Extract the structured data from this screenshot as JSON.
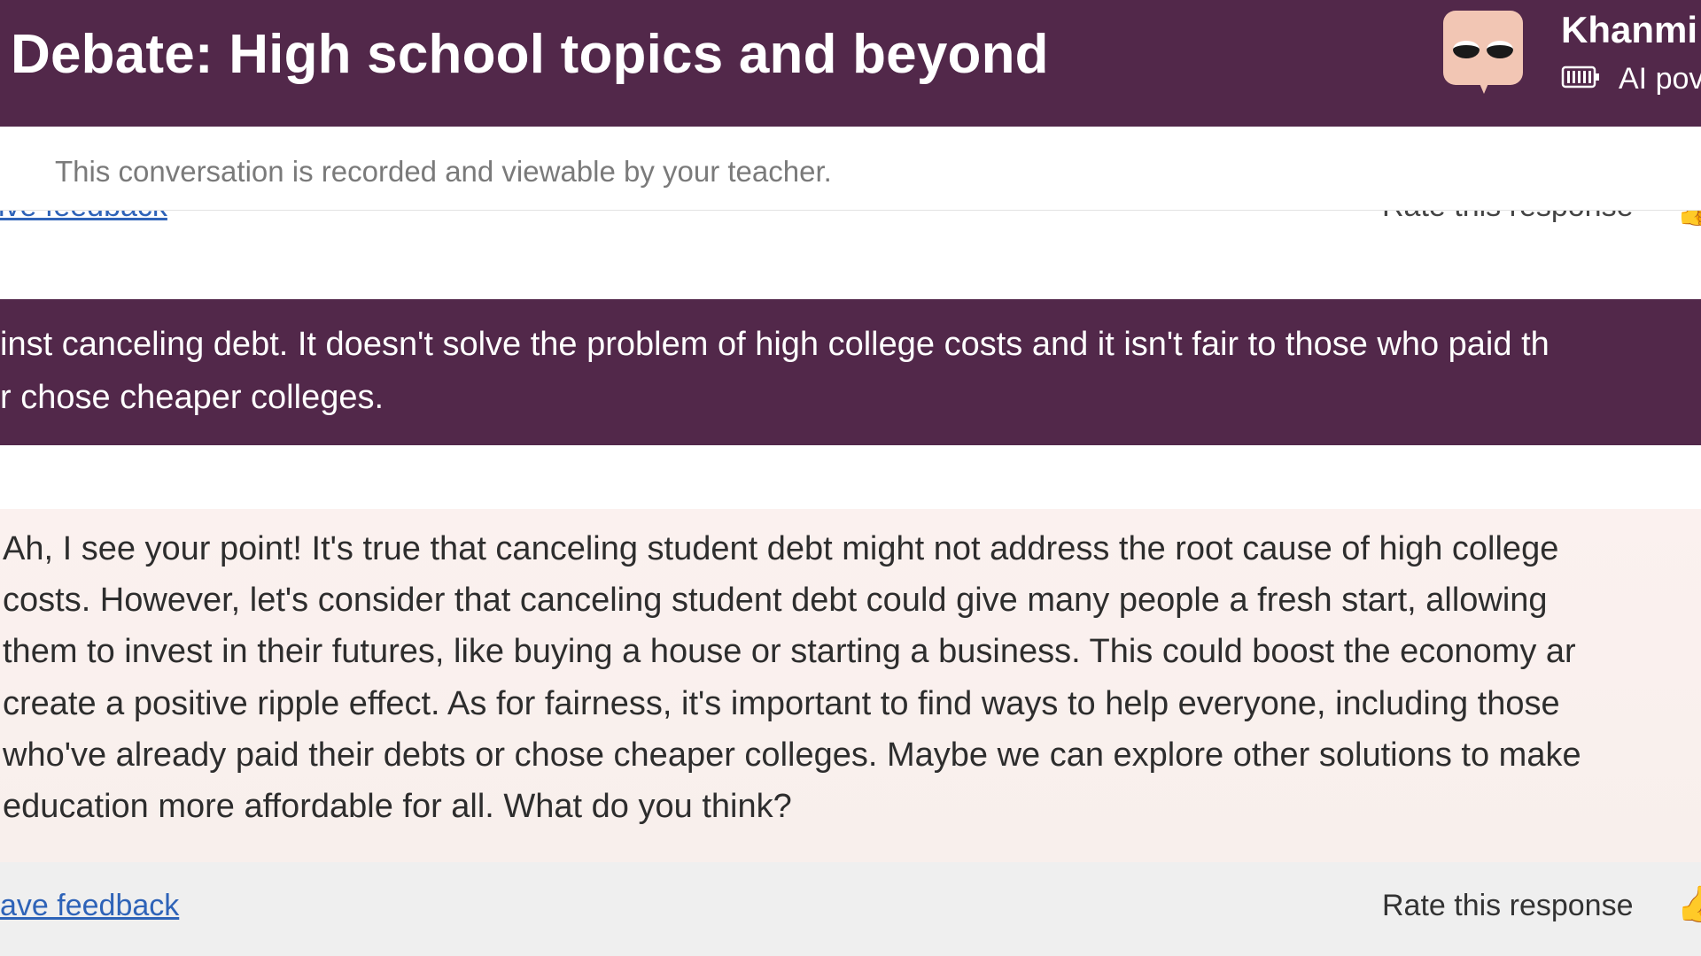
{
  "header": {
    "title": "Debate: High school topics and beyond",
    "brand_name": "Khanmi",
    "brand_sub": "AI pov",
    "avatar_icon": "owl-eyes-avatar-icon",
    "battery_icon": "battery-icon",
    "background_color": "#52284a"
  },
  "notice": {
    "text": "This conversation is recorded and viewable by your teacher."
  },
  "previous_feedback": {
    "link_text": "ive feedback",
    "rate_label": "Rate this response"
  },
  "messages": {
    "user": {
      "lines": [
        "inst canceling debt. It doesn't solve the problem of high college costs and it isn't fair to those who paid th",
        "r chose cheaper colleges."
      ]
    },
    "ai": {
      "lines": [
        "Ah, I see your point! It's true that canceling student debt might not address the root cause of high college",
        "costs. However, let's consider that canceling student debt could give many people a fresh start, allowing",
        "them to invest in their futures, like buying a house or starting a business. This could boost the economy ar",
        "create a positive ripple effect. As for fairness, it's important to find ways to help everyone, including those",
        "who've already paid their debts or chose cheaper colleges. Maybe we can explore other solutions to make",
        "education more affordable for all. What do you think?"
      ]
    }
  },
  "feedback": {
    "link_text": "ave feedback",
    "rate_label": "Rate this response",
    "thumb_icon": "thumbs-up-icon"
  },
  "colors": {
    "accent_purple": "#52284a",
    "link_blue": "#2e63b8",
    "ai_bubble": "#fbf1ef",
    "thumb_yellow": "#e5b626"
  }
}
